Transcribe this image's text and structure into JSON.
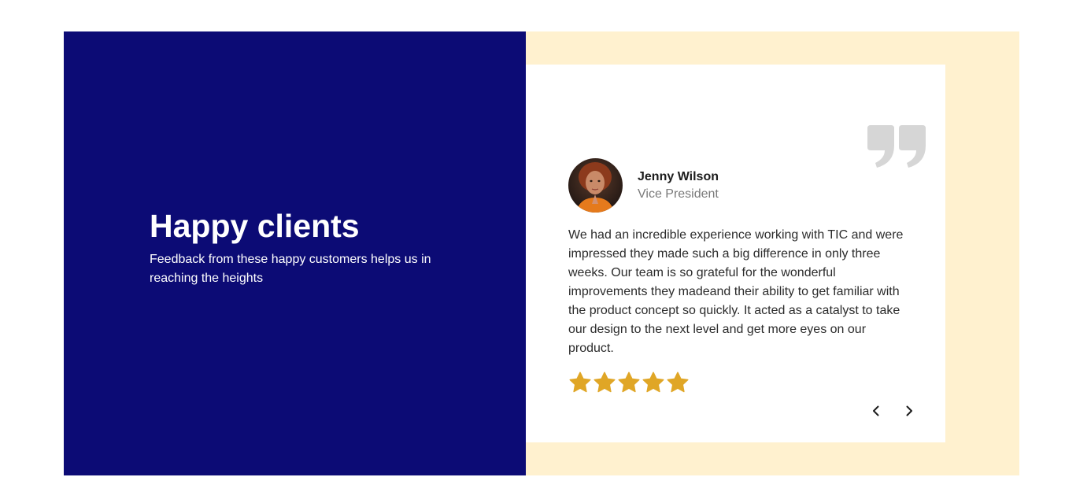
{
  "intro": {
    "title": "Happy clients",
    "subtitle": "Feedback from these happy customers helps us in reaching the heights"
  },
  "testimonial": {
    "name": "Jenny Wilson",
    "role": "Vice President",
    "text": "We had an incredible experience working with TIC and were impressed they made such a big difference in only three weeks. Our team is so grateful for the wonderful improvements they madeand their ability to get familiar with the product concept so quickly. It acted as a catalyst to take our design to the next level and get more eyes on our product.",
    "rating": 5,
    "rating_max": 5
  },
  "icons": {
    "quote": "quote-icon",
    "star": "star-icon",
    "prev": "chevron-left-icon",
    "next": "chevron-right-icon"
  },
  "colors": {
    "primary": "#0c0b75",
    "accent_bg": "#fff1cf",
    "star": "#e0a626",
    "quote": "#d6d6d6"
  }
}
